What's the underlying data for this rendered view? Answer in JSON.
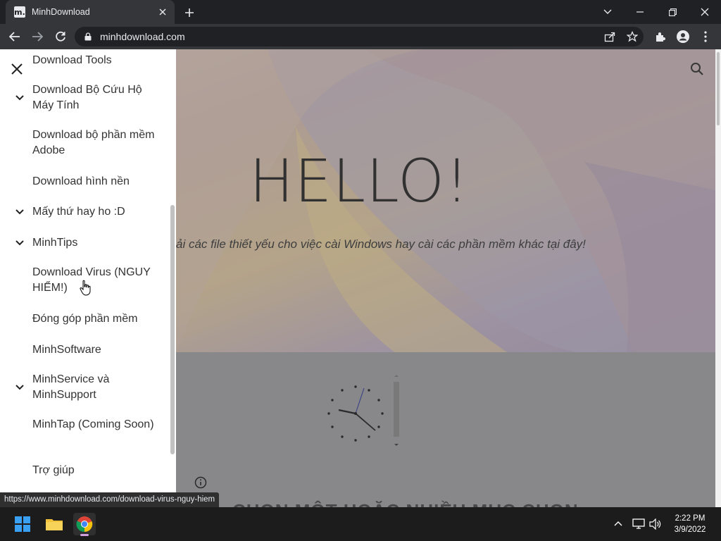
{
  "browser": {
    "tab_title": "MinhDownload",
    "favicon_text": "m.",
    "url": "minhdownload.com",
    "status_url": "https://www.minhdownload.com/download-virus-nguy-hiem"
  },
  "page": {
    "hero_title": "HELLO!",
    "hero_subtitle": "ải các file thiết yếu cho việc cài Windows hay cài các phần mềm khác tại đây!",
    "bottom_text": "CHỌN MỘT HOẶC NHIỀU MỤC CHỌN"
  },
  "sidebar": {
    "items": [
      {
        "label": "Download Tools",
        "expandable": false
      },
      {
        "label": "Download Bộ Cứu Hộ Máy Tính",
        "expandable": true
      },
      {
        "label": "Download bộ phần mềm Adobe",
        "expandable": false
      },
      {
        "label": "Download hình nền",
        "expandable": false
      },
      {
        "label": "Mấy thứ hay ho :D",
        "expandable": true
      },
      {
        "label": "MinhTips",
        "expandable": true
      },
      {
        "label": "Download Virus (NGUY HIỂM!)",
        "expandable": false
      },
      {
        "label": "Đóng góp phần mềm",
        "expandable": false
      },
      {
        "label": "MinhSoftware",
        "expandable": false
      },
      {
        "label": "MinhService và MinhSupport",
        "expandable": true
      },
      {
        "label": "MinhTap (Coming Soon)",
        "expandable": false
      },
      {
        "label": "Trợ giúp",
        "expandable": false
      }
    ]
  },
  "taskbar": {
    "time": "2:22 PM",
    "date": "3/9/2022"
  },
  "colors": {
    "browser_frame": "#202124",
    "toolbar": "#35363a",
    "sidebar_bg": "#ffffff",
    "taskbar": "#1c1c1c"
  }
}
